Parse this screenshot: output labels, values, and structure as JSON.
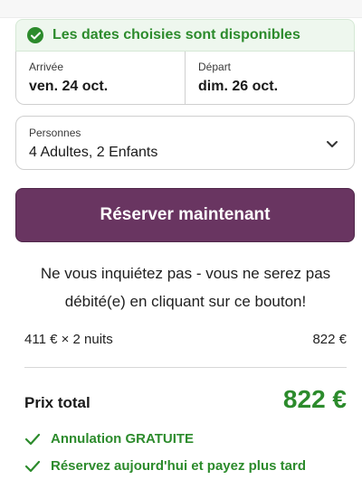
{
  "availability": {
    "text": "Les dates choisies sont disponibles"
  },
  "dates": {
    "arrival": {
      "label": "Arrivée",
      "value": "ven. 24 oct."
    },
    "departure": {
      "label": "Départ",
      "value": "dim. 26 oct."
    }
  },
  "persons": {
    "label": "Personnes",
    "value": "4 Adultes, 2 Enfants"
  },
  "reserve_button": {
    "label": "Réserver maintenant"
  },
  "reassurance": {
    "line1": "Ne vous inquiétez pas - vous ne serez pas",
    "line2": "débité(e) en cliquant sur ce bouton!"
  },
  "pricing": {
    "nightly_calc": "411 € × 2 nuits",
    "nightly_amount": "822 €",
    "total_label": "Prix total",
    "total_value": "822 €"
  },
  "perks": [
    {
      "text": "Annulation GRATUITE"
    },
    {
      "text": "Réservez aujourd'hui et payez plus tard"
    }
  ],
  "colors": {
    "accent": "#693561",
    "success": "#2c8b2c",
    "banner_bg": "#eef7ee"
  },
  "icons": {
    "availability": "check-circle-icon",
    "persons": "chevron-down-icon",
    "perk": "check-icon"
  }
}
